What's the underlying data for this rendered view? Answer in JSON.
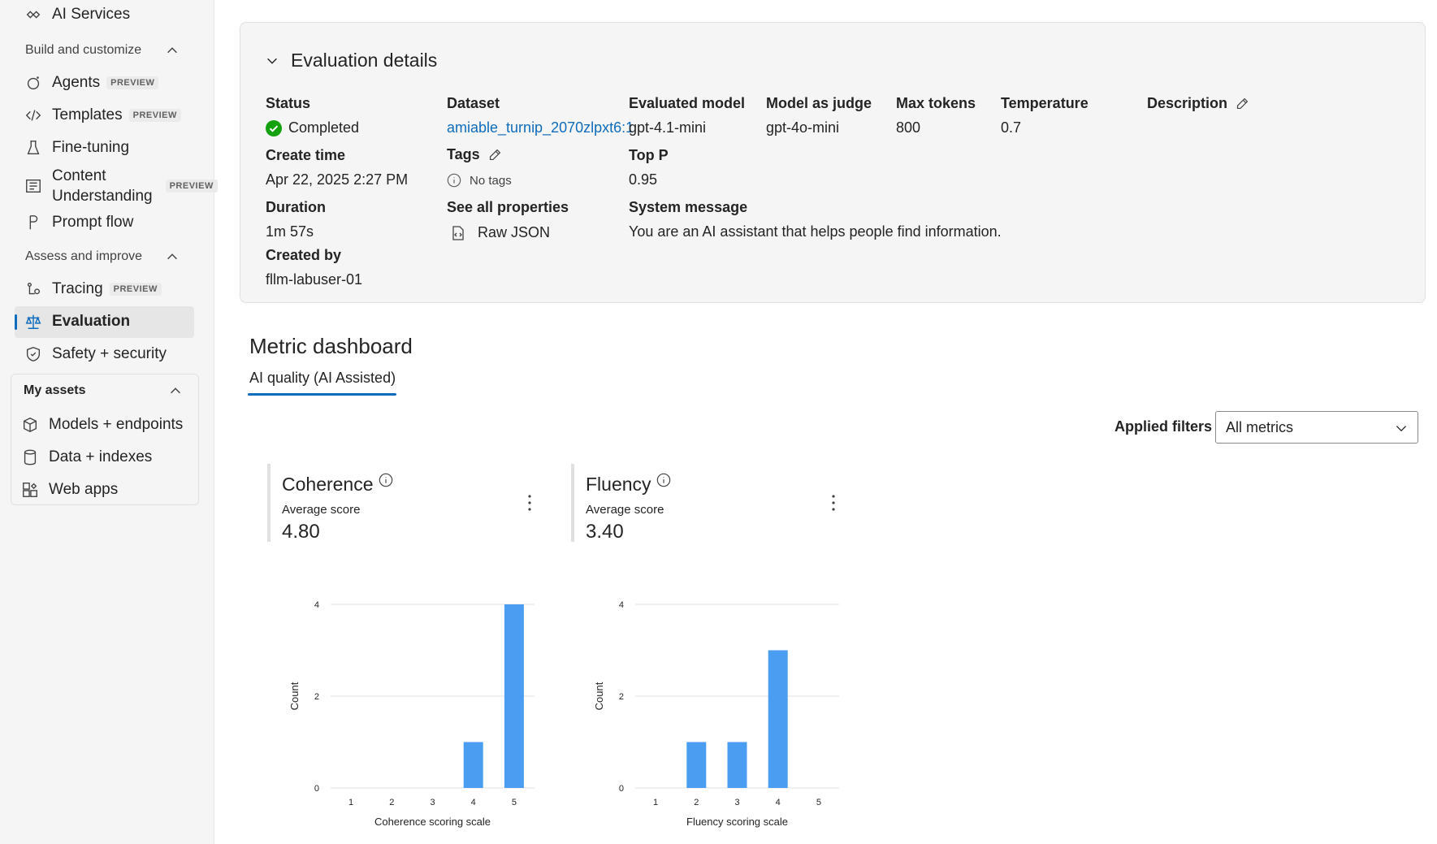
{
  "sidebar": {
    "top_item": "AI Services",
    "build_header": "Build and customize",
    "build_items": [
      {
        "label": "Agents",
        "badge": "PREVIEW"
      },
      {
        "label": "Templates",
        "badge": "PREVIEW"
      },
      {
        "label": "Fine-tuning"
      },
      {
        "label": "Content Understanding",
        "badge": "PREVIEW"
      },
      {
        "label": "Prompt flow"
      }
    ],
    "assess_header": "Assess and improve",
    "assess_items": [
      {
        "label": "Tracing",
        "badge": "PREVIEW"
      },
      {
        "label": "Evaluation",
        "selected": true
      },
      {
        "label": "Safety + security"
      }
    ],
    "assets_header": "My assets",
    "asset_items": [
      {
        "label": "Models + endpoints"
      },
      {
        "label": "Data + indexes"
      },
      {
        "label": "Web apps"
      }
    ],
    "content_line1": "Content",
    "content_line2": "Understanding"
  },
  "details": {
    "title": "Evaluation details",
    "status_label": "Status",
    "status_value": "Completed",
    "create_time_label": "Create time",
    "create_time_value": "Apr 22, 2025 2:27 PM",
    "duration_label": "Duration",
    "duration_value": "1m 57s",
    "created_by_label": "Created by",
    "created_by_value": "fllm-labuser-01",
    "dataset_label": "Dataset",
    "dataset_value": "amiable_turnip_2070zlpxt6:1",
    "tags_label": "Tags",
    "tags_value": "No tags",
    "see_all_label": "See all properties",
    "raw_json": "Raw JSON",
    "evaluated_model_label": "Evaluated model",
    "evaluated_model_value": "gpt-4.1-mini",
    "judge_label": "Model as judge",
    "judge_value": "gpt-4o-mini",
    "max_tokens_label": "Max tokens",
    "max_tokens_value": "800",
    "temperature_label": "Temperature",
    "temperature_value": "0.7",
    "description_label": "Description",
    "top_p_label": "Top P",
    "top_p_value": "0.95",
    "system_message_label": "System message",
    "system_message_value": "You are an AI assistant that helps people find information."
  },
  "dashboard": {
    "title": "Metric dashboard",
    "tab": "AI quality (AI Assisted)",
    "filters_label": "Applied filters",
    "filter_value": "All metrics",
    "metrics": [
      {
        "name": "Coherence",
        "score_label": "Average score",
        "score": "4.80"
      },
      {
        "name": "Fluency",
        "score_label": "Average score",
        "score": "3.40"
      }
    ]
  },
  "chart_data": [
    {
      "type": "bar",
      "categories": [
        "1",
        "2",
        "3",
        "4",
        "5"
      ],
      "values": [
        0,
        0,
        0,
        1,
        4
      ],
      "xlabel": "Coherence scoring scale",
      "ylabel": "Count",
      "ylim": [
        0,
        4
      ],
      "yticks": [
        "0",
        "2",
        "4"
      ],
      "color": "#4a9df0"
    },
    {
      "type": "bar",
      "categories": [
        "1",
        "2",
        "3",
        "4",
        "5"
      ],
      "values": [
        0,
        1,
        1,
        3,
        0
      ],
      "xlabel": "Fluency scoring scale",
      "ylabel": "Count",
      "ylim": [
        0,
        4
      ],
      "yticks": [
        "0",
        "2",
        "4"
      ],
      "color": "#4a9df0"
    }
  ]
}
